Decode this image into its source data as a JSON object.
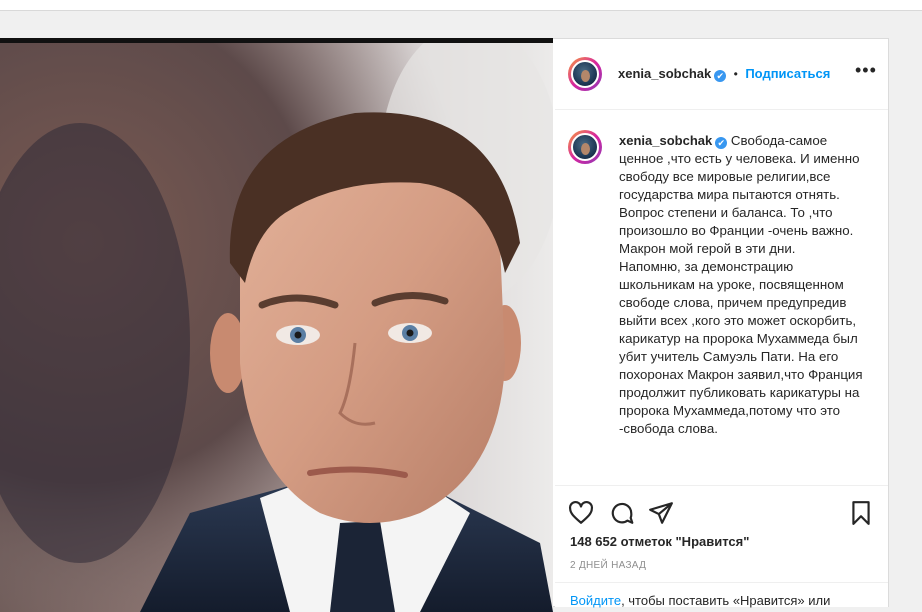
{
  "post": {
    "username": "xenia_sobchak",
    "verified_badge": "✔",
    "follow_label": "Подписаться",
    "separator": "•",
    "more_label": "•••",
    "caption": "Свобода-самое ценное ,что есть у человека. И именно свободу все мировые религии,все государства мира пытаются отнять. Вопрос степени и баланса. То ,что произошло во Франции -очень важно. Макрон мой герой в эти дни.\nНапомню, за демонстрацию школьникам на уроке, посвященном свободе слова, причем предупредив выйти всех ,кого это может оскорбить, карикатур на пророка Мухаммеда был убит учитель Самуэль Пати. На его похоронах Макрон заявил,что Франция продолжит публиковать карикатуры на пророка Мухаммеда,потому что это -свобода слова.",
    "likes_text": "148 652 отметок \"Нравится\"",
    "date_text": "2 ДНЕЙ НАЗАД",
    "login_link": "Войдите",
    "login_rest": ", чтобы поставить «Нравится» или"
  },
  "icons": {
    "like": "heart-icon",
    "comment": "comment-icon",
    "share": "share-icon",
    "save": "bookmark-icon",
    "more": "more-icon"
  },
  "colors": {
    "link": "#0095f6",
    "verified": "#3897f0",
    "text": "#262626",
    "muted": "#8e8e8e",
    "border": "#dbdbdb"
  }
}
